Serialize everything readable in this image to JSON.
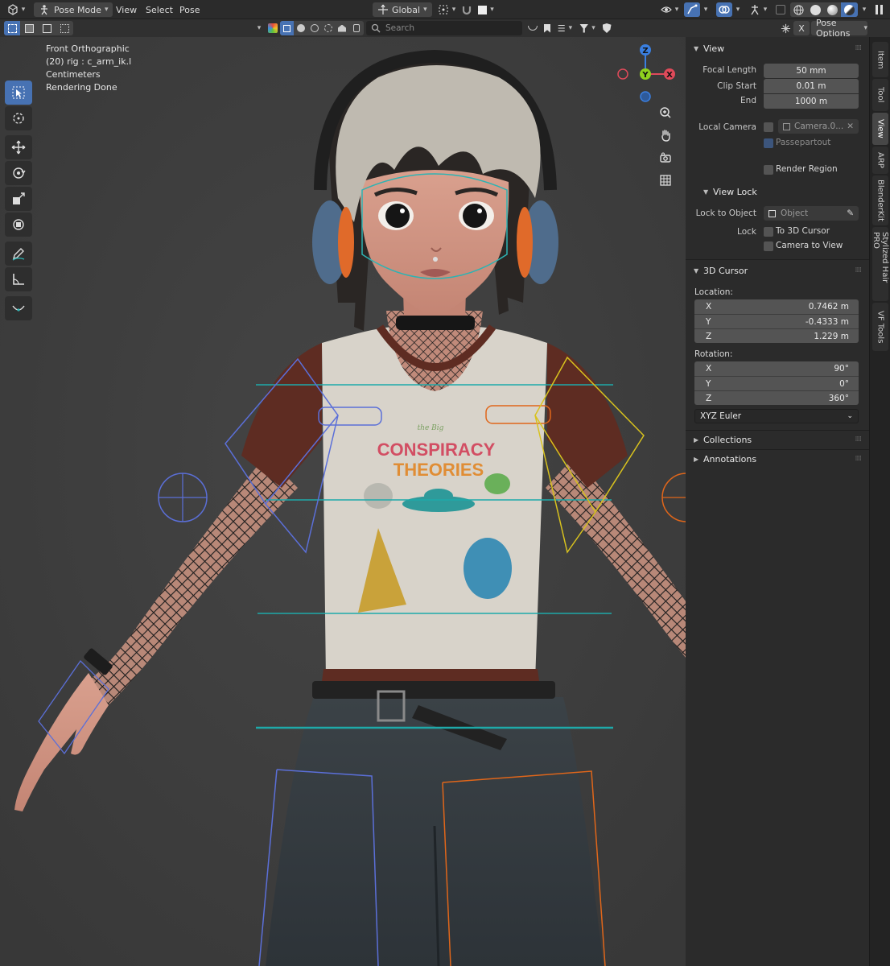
{
  "header": {
    "mode": "Pose Mode",
    "menus": [
      "View",
      "Select",
      "Pose"
    ],
    "transform_orientation": "Global",
    "search_placeholder": "Search",
    "pose_options": "Pose Options",
    "x_label": "X"
  },
  "overlay": {
    "view_name": "Front Orthographic",
    "object_info": "(20) rig : c_arm_ik.l",
    "units": "Centimeters",
    "status": "Rendering Done"
  },
  "gizmo": {
    "z": "Z",
    "y": "Y",
    "x": "X"
  },
  "tabs": [
    "Item",
    "Tool",
    "View",
    "ARP",
    "BlenderKit",
    "Stylized Hair PRO",
    "VF Tools"
  ],
  "panel": {
    "view": {
      "title": "View",
      "focal_length_label": "Focal Length",
      "focal_length": "50 mm",
      "clip_start_label": "Clip Start",
      "clip_start": "0.01 m",
      "end_label": "End",
      "end": "1000 m",
      "local_camera_label": "Local Camera",
      "local_camera_value": "Camera.0...",
      "passepartout": "Passepartout",
      "render_region": "Render Region"
    },
    "view_lock": {
      "title": "View Lock",
      "lock_to_object_label": "Lock to Object",
      "lock_to_object_placeholder": "Object",
      "lock_label": "Lock",
      "to_3d_cursor": "To 3D Cursor",
      "camera_to_view": "Camera to View"
    },
    "cursor": {
      "title": "3D Cursor",
      "location_label": "Location:",
      "location": [
        {
          "axis": "X",
          "value": "0.7462 m"
        },
        {
          "axis": "Y",
          "value": "-0.4333 m"
        },
        {
          "axis": "Z",
          "value": "1.229 m"
        }
      ],
      "rotation_label": "Rotation:",
      "rotation": [
        {
          "axis": "X",
          "value": "90°"
        },
        {
          "axis": "Y",
          "value": "0°"
        },
        {
          "axis": "Z",
          "value": "360°"
        }
      ],
      "rotation_mode": "XYZ Euler"
    },
    "collections": "Collections",
    "annotations": "Annotations"
  },
  "shirt": {
    "line1": "the Big",
    "line2": "CONSPIRACY",
    "line3": "THEORIES"
  },
  "colors": {
    "accent": "#4772b3",
    "bone_left": "#5b6fd8",
    "bone_right": "#e0661a",
    "bone_yellow": "#d8c21e",
    "bone_teal": "#1aa8a8",
    "axis_x": "#e04a5a",
    "axis_y": "#8fd11e",
    "axis_z": "#3a7fe0"
  }
}
